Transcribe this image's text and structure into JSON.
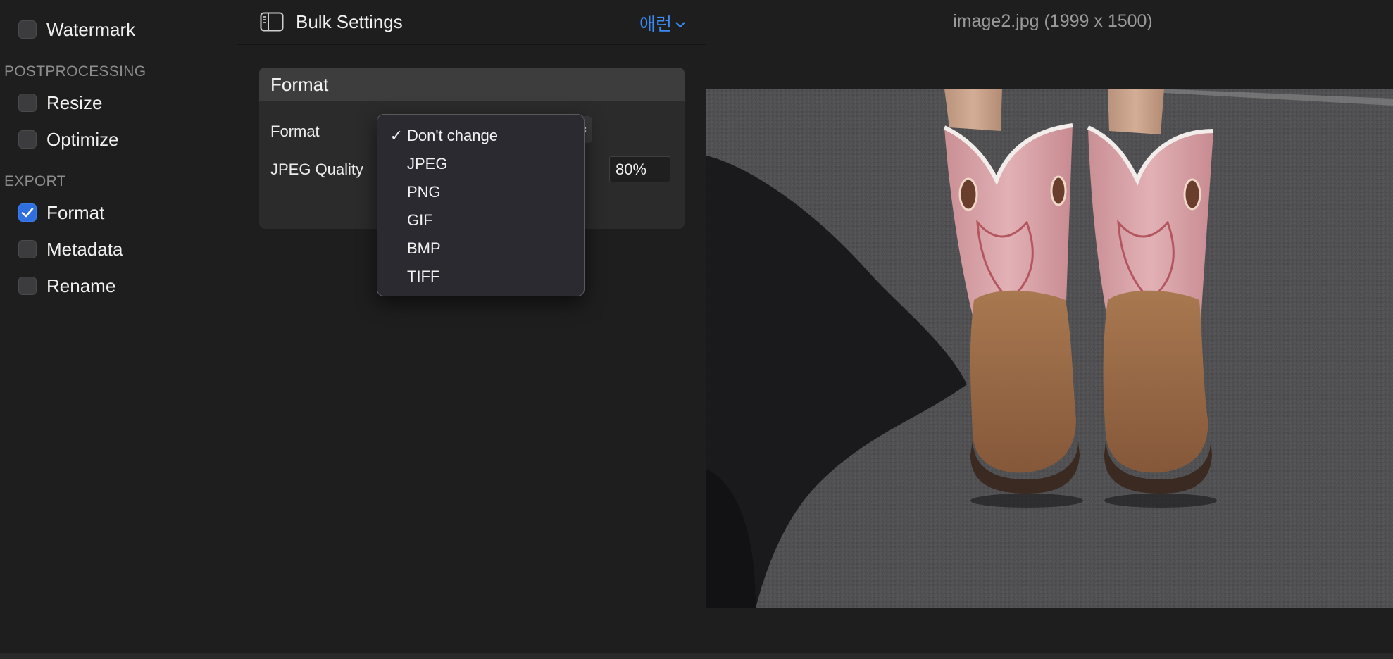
{
  "sidebar": {
    "items_top": [
      {
        "label": "Watermark",
        "checked": false
      }
    ],
    "sections": [
      {
        "title": "POSTPROCESSING",
        "items": [
          {
            "label": "Resize",
            "checked": false
          },
          {
            "label": "Optimize",
            "checked": false
          }
        ]
      },
      {
        "title": "EXPORT",
        "items": [
          {
            "label": "Format",
            "checked": true
          },
          {
            "label": "Metadata",
            "checked": false
          },
          {
            "label": "Rename",
            "checked": false
          }
        ]
      }
    ]
  },
  "middle": {
    "title": "Bulk Settings",
    "preset_label": "애런",
    "card": {
      "title": "Format",
      "format_label": "Format",
      "quality_label": "JPEG Quality",
      "quality_value": "80%"
    },
    "format_menu": {
      "options": [
        "Don't change",
        "JPEG",
        "PNG",
        "GIF",
        "BMP",
        "TIFF"
      ],
      "selected": "Don't change",
      "check_glyph": "✓"
    }
  },
  "preview": {
    "title": "image2.jpg (1999 x 1500)"
  },
  "colors": {
    "accent": "#3b8cf5",
    "checkbox_on": "#2f6fe0",
    "boot_pink": "#d9a3a8",
    "boot_brown": "#9a6a44",
    "asphalt": "#4d4d4f"
  },
  "icons": {
    "sidebar_toggle": "sidebar-toggle-icon",
    "chevron": "chevron-down-icon",
    "check": "checkmark-icon",
    "stepper": "up-down-chevron-icon"
  }
}
